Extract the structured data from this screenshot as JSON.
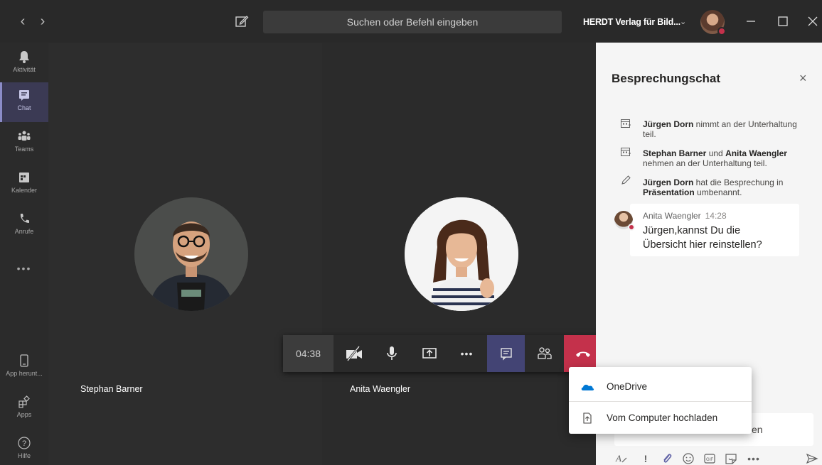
{
  "topbar": {
    "search_placeholder": "Suchen oder Befehl eingeben",
    "org_name": "HERDT Verlag für Bild...",
    "org_chevron": "⌄",
    "back": "‹",
    "forward": "›"
  },
  "rail": {
    "items": [
      {
        "label": "Aktivität",
        "icon": "bell-icon"
      },
      {
        "label": "Chat",
        "icon": "chat-icon"
      },
      {
        "label": "Teams",
        "icon": "teams-icon"
      },
      {
        "label": "Kalender",
        "icon": "calendar-icon"
      },
      {
        "label": "Anrufe",
        "icon": "phone-icon"
      }
    ],
    "more": "•••",
    "bottom": [
      {
        "label": "App herunt...",
        "icon": "device-icon"
      },
      {
        "label": "Apps",
        "icon": "apps-icon"
      },
      {
        "label": "Hilfe",
        "icon": "help-icon"
      }
    ]
  },
  "stage": {
    "participants": [
      {
        "name": "Stephan Barner"
      },
      {
        "name": "Anita Waengler"
      }
    ]
  },
  "callbar": {
    "timer": "04:38",
    "buttons": [
      "camera-off-icon",
      "mic-icon",
      "share-screen-icon",
      "more-icon",
      "chat-icon",
      "participants-icon",
      "hangup-icon"
    ],
    "more_glyph": "•••"
  },
  "panel": {
    "title": "Besprechungschat",
    "close": "×",
    "system_messages": [
      {
        "who": "Jürgen Dorn",
        "text": " nimmt an der Unterhaltung teil."
      },
      {
        "who": "Stephan Barner",
        "mid": " und ",
        "who2": "Anita Waengler",
        "text": " nehmen an der Unterhaltung teil."
      },
      {
        "who": "Jürgen Dorn",
        "text": " hat die Besprechung in ",
        "who2": "Präsentation",
        "text2": " umbenannt."
      }
    ],
    "message": {
      "author": "Anita Waengler",
      "time": "14:28",
      "text": "Jürgen,kannst Du die Übersicht hier reinstellen?"
    },
    "compose_partial": "en",
    "format_more": "•••"
  },
  "attach_menu": {
    "items": [
      {
        "label": "OneDrive",
        "icon": "onedrive-icon"
      },
      {
        "label": "Vom Computer hochladen",
        "icon": "upload-icon"
      }
    ]
  },
  "colors": {
    "accent": "#6264a7",
    "hangup": "#c4314b",
    "presence_busy": "#c4314b",
    "onedrive": "#0078d4"
  }
}
